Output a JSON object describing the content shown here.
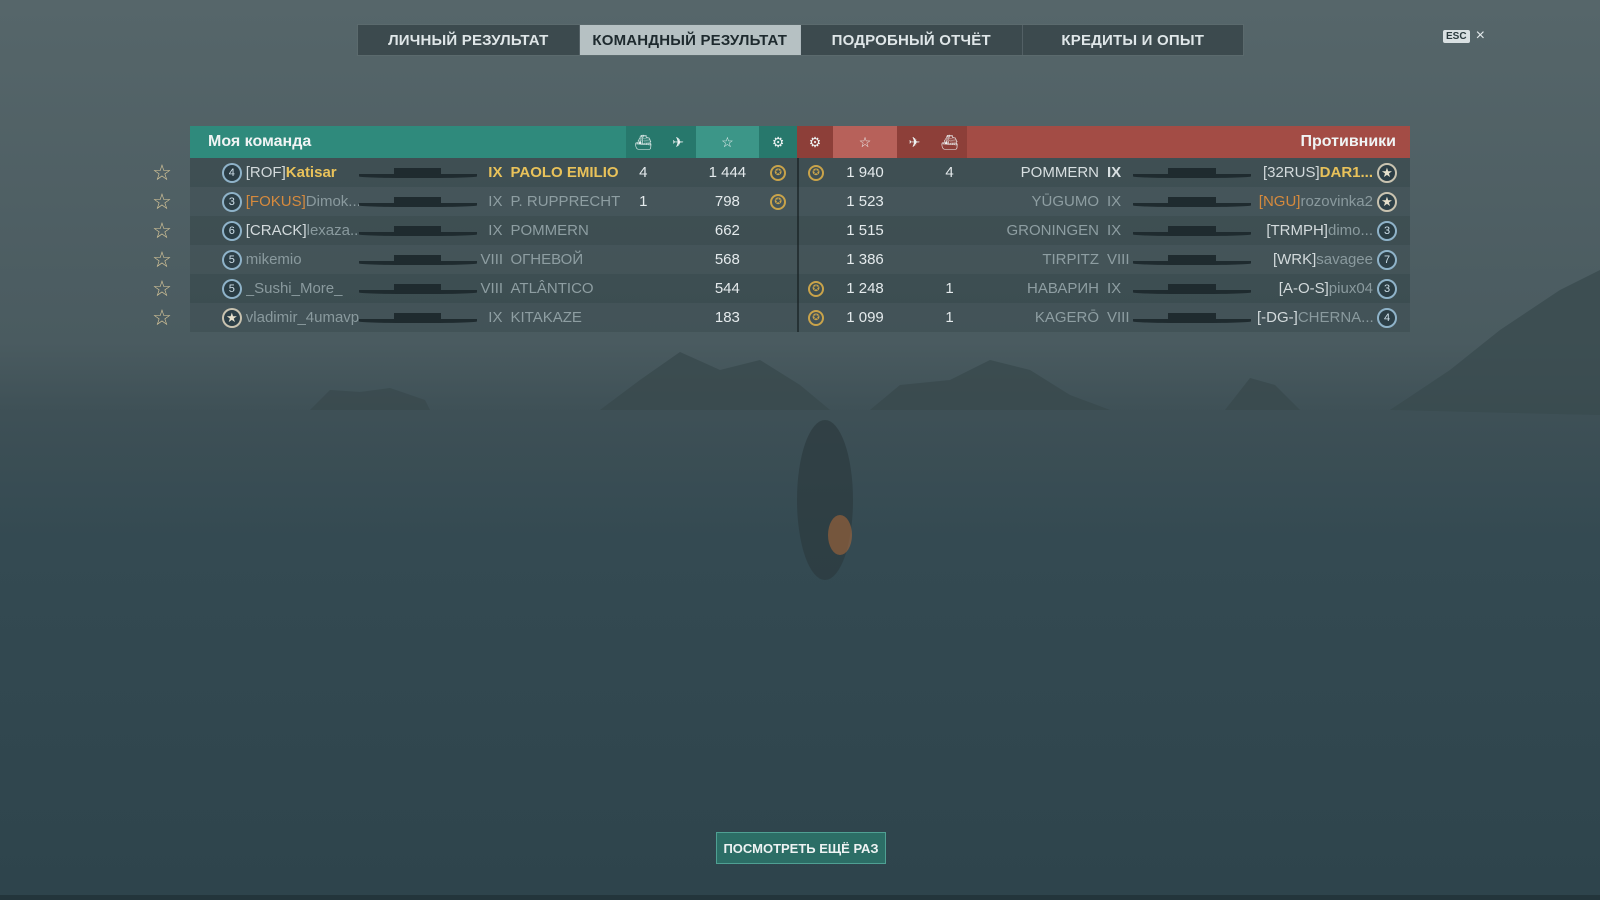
{
  "tabs": [
    {
      "label": "ЛИЧНЫЙ РЕЗУЛЬТАТ",
      "active": false
    },
    {
      "label": "КОМАНДНЫЙ РЕЗУЛЬТАТ",
      "active": true
    },
    {
      "label": "ПОДРОБНЫЙ ОТЧЁТ",
      "active": false
    },
    {
      "label": "КРЕДИТЫ И ОПЫТ",
      "active": false
    }
  ],
  "close": {
    "key": "ESC",
    "icon": "×"
  },
  "my_team": {
    "title": "Моя команда",
    "color": "#2f8a7c",
    "rows": [
      {
        "rank": "4",
        "clan": "[ROF]",
        "nick": "Katisar",
        "tier": "IX",
        "ship": "PAOLO EMILIO",
        "kills": "4",
        "planes": "",
        "xp": "1 444",
        "medal": true,
        "me": true
      },
      {
        "rank": "3",
        "clan": "[FOKUS]",
        "nick": "Dimok...",
        "tier": "IX",
        "ship": "P. RUPPRECHT",
        "kills": "1",
        "planes": "",
        "xp": "798",
        "medal": true,
        "clan_gold": true
      },
      {
        "rank": "6",
        "clan": "[CRACK]",
        "nick": "lexaza...",
        "tier": "IX",
        "ship": "POMMERN",
        "kills": "",
        "planes": "",
        "xp": "662",
        "medal": false
      },
      {
        "rank": "5",
        "clan": "",
        "nick": "mikemio",
        "tier": "VIII",
        "ship": "ОГНЕВОЙ",
        "kills": "",
        "planes": "",
        "xp": "568",
        "medal": false
      },
      {
        "rank": "5",
        "clan": "",
        "nick": "_Sushi_More_",
        "tier": "VIII",
        "ship": "ATLÂNTICO",
        "kills": "",
        "planes": "",
        "xp": "544",
        "medal": false
      },
      {
        "rank": "★",
        "clan": "",
        "nick": "vladimir_4umavp",
        "tier": "IX",
        "ship": "KITAKAZE",
        "kills": "",
        "planes": "",
        "xp": "183",
        "medal": false,
        "star_rank": true
      }
    ]
  },
  "enemy_team": {
    "title": "Противники",
    "color": "#a34c45",
    "rows": [
      {
        "rank": "★",
        "clan": "[32RUS]",
        "nick": "DAR1...",
        "tier": "IX",
        "ship": "POMMERN",
        "kills": "4",
        "planes": "",
        "xp": "1 940",
        "medal": true,
        "star_rank": true,
        "top": true
      },
      {
        "rank": "★",
        "clan": "[NGU]",
        "nick": "rozovinka2",
        "tier": "IX",
        "ship": "YŪGUMO",
        "kills": "",
        "planes": "",
        "xp": "1 523",
        "medal": false,
        "star_rank": true,
        "clan_gold": true
      },
      {
        "rank": "3",
        "clan": "[TRMPH]",
        "nick": "dimo...",
        "tier": "IX",
        "ship": "GRONINGEN",
        "kills": "",
        "planes": "",
        "xp": "1 515",
        "medal": false
      },
      {
        "rank": "7",
        "clan": "[WRK]",
        "nick": "savagee",
        "tier": "VIII",
        "ship": "TIRPITZ",
        "kills": "",
        "planes": "",
        "xp": "1 386",
        "medal": false
      },
      {
        "rank": "3",
        "clan": "[A-O-S]",
        "nick": "piux04",
        "tier": "IX",
        "ship": "НАВАРИН",
        "kills": "1",
        "planes": "",
        "xp": "1 248",
        "medal": true
      },
      {
        "rank": "4",
        "clan": "[-DG-]",
        "nick": "CHERNA...",
        "tier": "VIII",
        "ship": "KAGERŌ",
        "kills": "1",
        "planes": "",
        "xp": "1 099",
        "medal": true
      }
    ]
  },
  "column_icons": {
    "kills": "ship-sunk-icon",
    "planes": "plane-shot-icon",
    "xp": "star-icon",
    "medal": "medal-icon"
  },
  "replay_button": "ПОСМОТРЕТЬ ЕЩЁ РАЗ"
}
